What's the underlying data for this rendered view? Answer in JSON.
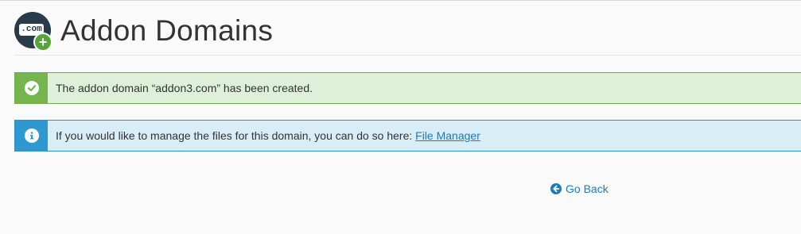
{
  "header": {
    "title": "Addon Domains",
    "icon_text": ".com",
    "icon_plus": "+"
  },
  "alerts": {
    "success": {
      "icon": "check-icon",
      "message": "The addon domain “addon3.com” has been created."
    },
    "info": {
      "icon": "info-icon",
      "message": "If you would like to manage the files for this domain, you can do so here: ",
      "link_label": "File Manager"
    }
  },
  "go_back": {
    "icon": "arrow-left-circle-icon",
    "label": "Go Back"
  },
  "colors": {
    "success_accent": "#74b54f",
    "success_bg": "#dff0d8",
    "info_accent": "#2d98d2",
    "info_bg": "#d9edf7",
    "link": "#1a7ab9"
  }
}
